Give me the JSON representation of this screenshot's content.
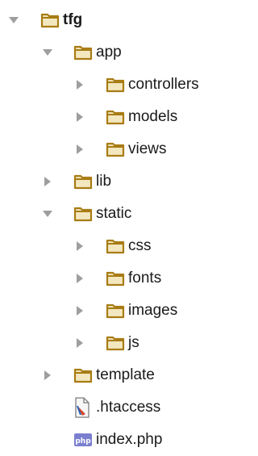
{
  "tree": [
    {
      "label": "tfg",
      "type": "folder",
      "expanded": true,
      "depth": 0,
      "bold": true
    },
    {
      "label": "app",
      "type": "folder",
      "expanded": true,
      "depth": 1
    },
    {
      "label": "controllers",
      "type": "folder",
      "expanded": false,
      "depth": 2
    },
    {
      "label": "models",
      "type": "folder",
      "expanded": false,
      "depth": 2
    },
    {
      "label": "views",
      "type": "folder",
      "expanded": false,
      "depth": 2
    },
    {
      "label": "lib",
      "type": "folder",
      "expanded": false,
      "depth": 1
    },
    {
      "label": "static",
      "type": "folder",
      "expanded": true,
      "depth": 1
    },
    {
      "label": "css",
      "type": "folder",
      "expanded": false,
      "depth": 2
    },
    {
      "label": "fonts",
      "type": "folder",
      "expanded": false,
      "depth": 2
    },
    {
      "label": "images",
      "type": "folder",
      "expanded": false,
      "depth": 2
    },
    {
      "label": "js",
      "type": "folder",
      "expanded": false,
      "depth": 2
    },
    {
      "label": "template",
      "type": "folder",
      "expanded": false,
      "depth": 1
    },
    {
      "label": ".htaccess",
      "type": "file-htaccess",
      "depth": 1
    },
    {
      "label": "index.php",
      "type": "file-php",
      "depth": 1
    }
  ],
  "colors": {
    "folder_outline": "#a87c15",
    "folder_fill": "#f3e7bf",
    "arrow": "#9e9e9e",
    "php_badge": "#7a7fcf",
    "htaccess_flag": "#d0472c"
  },
  "icons": {
    "arrow_expanded": "triangle-down-icon",
    "arrow_collapsed": "triangle-right-icon",
    "folder": "folder-icon",
    "htaccess": "htaccess-file-icon",
    "php": "php-file-icon"
  },
  "php_badge_text": "php"
}
